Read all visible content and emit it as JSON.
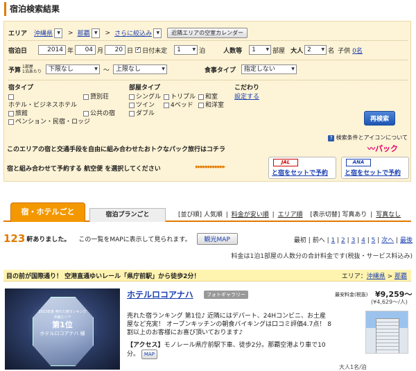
{
  "page_title": "宿泊検索結果",
  "search": {
    "area_label": "エリア",
    "prefecture": "沖縄県",
    "city": "那覇",
    "narrow": "さらに絞込み",
    "calendar_button": "近隣エリアの空室カレンダー",
    "checkin_label": "宿泊日",
    "year": "2014",
    "year_unit": "年",
    "month": "04",
    "month_unit": "月",
    "day": "20",
    "day_unit": "日",
    "undecided": "日付未定",
    "nights": "1",
    "nights_unit": "泊",
    "people_label": "人数等",
    "rooms": "1",
    "rooms_unit": "部屋",
    "adults_label": "大人",
    "adults": "2",
    "adults_unit": "名",
    "children_label": "子供",
    "children_value": "0名",
    "budget_label": "予算",
    "budget_sub1": "1部屋",
    "budget_sub2": "1泊あたり",
    "budget_min": "下限なし",
    "budget_tilde": "〜",
    "budget_max": "上限なし",
    "meal_label": "食事タイプ",
    "meal_value": "指定しない",
    "lodging_type_label": "宿タイプ",
    "lodging_types": [
      "ホテル・ビジネスホテル",
      "貸別荘",
      "旅館",
      "公共の宿",
      "ペンション・民宿・ロッジ"
    ],
    "room_type_label": "部屋タイプ",
    "room_types": [
      "シングル",
      "トリプル",
      "和室",
      "ツイン",
      "4ベッド",
      "和洋室",
      "ダブル"
    ],
    "kodawari_label": "こだわり",
    "kodawari_link": "設定する",
    "research_button": "再検索",
    "help_link": "検索条件とアイコンについて"
  },
  "pack": {
    "banner_text": "このエリアの宿と交通手段を自由に組み合わせたおトクなパック旅行はコチラ",
    "logo": "パック",
    "select_text": "宿と組み合わせて予約する 航空便 を選択してください",
    "arrows": "▸▸▸▸▸▸▸▸▸▸▸▸",
    "jal_logo": "JAL",
    "jal_button": "と宿をセットで予約",
    "ana_logo": "ANA",
    "ana_button": "と宿をセットで予約"
  },
  "tabs": {
    "hotel_tab": "宿・ホテルごと",
    "plan_tab": "宿泊プランごと",
    "sort_label": "[並び順]",
    "sort_popular": "人気順",
    "sort_cheap": "料金が安い順",
    "sort_area": "エリア順",
    "display_label": "[表示切替]",
    "display_photo": "写真あり",
    "display_nophoto": "写真なし"
  },
  "results": {
    "count": "123",
    "count_unit": "軒ありました。",
    "map_note": "この一覧をMAPに表示して見られます。",
    "map_button": "観光MAP",
    "pager_label": "最初",
    "pager_prev": "前へ",
    "pages": [
      "1",
      "2",
      "3",
      "4",
      "5"
    ],
    "pager_next": "次へ",
    "pager_last": "最後",
    "price_note": "料金は1泊1部屋の人数分の合計料金です(税抜・サービス料込み)"
  },
  "highlight": {
    "text": "目の前が国際通り！ 空港直通ゆいレール「県庁前駅」から徒歩2分！",
    "area_label": "エリア：",
    "area_pref": "沖縄県",
    "area_sep": " > ",
    "area_city": "那覇"
  },
  "hotel": {
    "name": "ホテルロコアナハ",
    "gallery_badge": "フォトギャラリー",
    "price_label": "最安料金(税抜)",
    "price": "¥9,259〜",
    "price_tax": "(¥4,629〜/人)",
    "desc1": "売れた宿ランキング 第1位♪ 近隣にはデパート、24Hコンビニ、お土産",
    "desc2": "屋など充実！ オープンキッチンの朝食バイキングは口コミ評価4.7点！ 8",
    "desc3": "割以上のお客様にお喜び頂いております♪",
    "access_label": "【アクセス】",
    "access": "モノレール県庁前駅下車、徒歩2分。那覇空港より車で10",
    "access2": "分。",
    "map_badge": "MAP",
    "per_person": "大人1名/泊",
    "award_line1": "2013年度 売れた宿ランキング",
    "award_line2": "沖縄エリア",
    "award_line3": "第1位",
    "award_line4": "ホテルロコアナハ 様",
    "colors": {
      "accent": "#e07a00",
      "highlight": "#fff3b0",
      "link": "#1a3fb0",
      "price": "#b00000"
    }
  }
}
